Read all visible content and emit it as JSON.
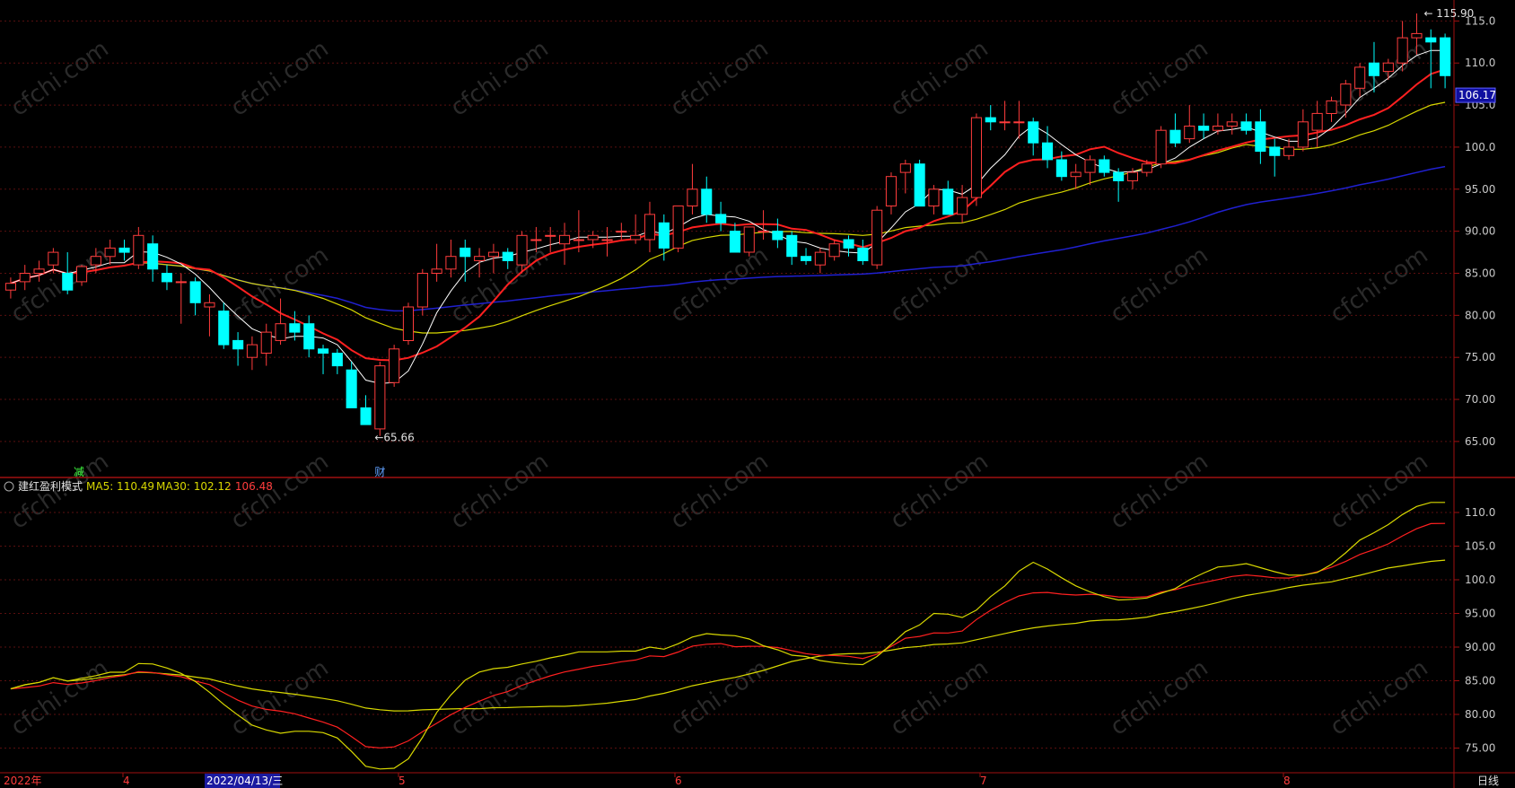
{
  "chart_data": [
    {
      "type": "candlestick",
      "panel": "main",
      "ylim": [
        62,
        116
      ],
      "yticks": [
        "115.0",
        "110.0",
        "105.0",
        "100.0",
        "95.00",
        "90.00",
        "85.00",
        "80.00",
        "75.00",
        "70.00",
        "65.00"
      ],
      "price_tag": "106.17",
      "high_annotation": "115.90",
      "low_annotation": "65.66",
      "markers": [
        "减",
        "财"
      ],
      "colors": {
        "up": "#ff3c3c",
        "down": "#00ffff",
        "ma5": "#ffffff",
        "ma10": "#ff2020",
        "ma20": "#d8d800",
        "ma60": "#2020d0"
      },
      "candles": [
        [
          83.0,
          84.5,
          82.0,
          83.8
        ],
        [
          84.0,
          86.0,
          83.0,
          85.0
        ],
        [
          85.0,
          86.5,
          84.0,
          85.5
        ],
        [
          86.0,
          88.0,
          85.0,
          87.5
        ],
        [
          85.0,
          87.5,
          82.5,
          83.0
        ],
        [
          84.0,
          86.0,
          83.5,
          85.8
        ],
        [
          86.0,
          88.0,
          85.0,
          87.0
        ],
        [
          87.0,
          89.0,
          86.0,
          88.0
        ],
        [
          88.0,
          89.0,
          86.5,
          87.5
        ],
        [
          86.0,
          90.5,
          85.5,
          89.5
        ],
        [
          88.5,
          89.5,
          84.0,
          85.5
        ],
        [
          85.0,
          86.0,
          83.0,
          84.0
        ],
        [
          84.0,
          85.0,
          79.0,
          84.0
        ],
        [
          84.0,
          84.5,
          80.0,
          81.5
        ],
        [
          81.0,
          82.5,
          77.5,
          81.5
        ],
        [
          80.5,
          81.5,
          76.0,
          76.5
        ],
        [
          77.0,
          78.0,
          74.0,
          76.0
        ],
        [
          75.0,
          77.5,
          73.5,
          76.5
        ],
        [
          75.5,
          79.0,
          74.0,
          78.0
        ],
        [
          77.0,
          82.0,
          76.5,
          79.0
        ],
        [
          79.0,
          80.5,
          77.0,
          78.0
        ],
        [
          79.0,
          80.0,
          75.0,
          76.0
        ],
        [
          76.0,
          76.5,
          73.0,
          75.5
        ],
        [
          75.5,
          76.0,
          73.0,
          74.0
        ],
        [
          73.5,
          74.5,
          69.0,
          69.0
        ],
        [
          69.0,
          70.5,
          67.0,
          67.0
        ],
        [
          66.5,
          74.5,
          65.66,
          74.0
        ],
        [
          72.0,
          76.5,
          71.5,
          76.0
        ],
        [
          77.0,
          81.5,
          76.5,
          81.0
        ],
        [
          81.0,
          85.5,
          80.0,
          85.0
        ],
        [
          85.0,
          88.5,
          84.0,
          85.5
        ],
        [
          85.5,
          89.0,
          84.5,
          87.0
        ],
        [
          88.0,
          89.0,
          84.0,
          87.0
        ],
        [
          86.5,
          88.0,
          84.5,
          87.0
        ],
        [
          87.0,
          88.5,
          85.0,
          87.5
        ],
        [
          87.5,
          88.0,
          85.5,
          86.5
        ],
        [
          86.0,
          90.0,
          85.0,
          89.5
        ],
        [
          89.0,
          90.5,
          87.5,
          89.0
        ],
        [
          89.5,
          90.5,
          87.5,
          89.5
        ],
        [
          88.5,
          91.0,
          86.0,
          89.5
        ],
        [
          89.0,
          92.5,
          87.5,
          89.0
        ],
        [
          89.0,
          90.0,
          88.0,
          89.5
        ],
        [
          89.0,
          90.5,
          87.0,
          89.0
        ],
        [
          90.0,
          91.0,
          89.0,
          90.0
        ],
        [
          89.0,
          92.0,
          88.5,
          89.5
        ],
        [
          89.0,
          93.5,
          87.5,
          92.0
        ],
        [
          91.0,
          92.0,
          86.5,
          88.0
        ],
        [
          88.0,
          93.0,
          87.5,
          93.0
        ],
        [
          93.0,
          98.0,
          92.0,
          95.0
        ],
        [
          95.0,
          96.5,
          91.0,
          92.0
        ],
        [
          92.0,
          93.5,
          90.0,
          91.0
        ],
        [
          90.0,
          91.0,
          87.5,
          87.5
        ],
        [
          87.5,
          90.5,
          87.0,
          90.5
        ],
        [
          90.0,
          92.5,
          89.0,
          90.0
        ],
        [
          90.0,
          91.5,
          88.0,
          89.0
        ],
        [
          89.5,
          90.0,
          86.0,
          87.0
        ],
        [
          87.0,
          88.0,
          86.0,
          86.5
        ],
        [
          86.0,
          88.0,
          85.0,
          87.5
        ],
        [
          87.0,
          89.0,
          86.5,
          88.5
        ],
        [
          89.0,
          89.5,
          87.0,
          88.0
        ],
        [
          88.0,
          89.0,
          86.0,
          86.5
        ],
        [
          86.0,
          93.0,
          85.5,
          92.5
        ],
        [
          93.0,
          97.0,
          92.0,
          96.5
        ],
        [
          97.0,
          98.5,
          94.5,
          98.0
        ],
        [
          98.0,
          98.5,
          93.0,
          93.0
        ],
        [
          93.0,
          95.5,
          92.0,
          95.0
        ],
        [
          95.0,
          96.0,
          92.0,
          92.0
        ],
        [
          92.0,
          95.5,
          91.0,
          94.0
        ],
        [
          94.0,
          104.0,
          93.0,
          103.5
        ],
        [
          103.5,
          105.0,
          102.0,
          103.0
        ],
        [
          103.0,
          105.5,
          102.0,
          103.0
        ],
        [
          103.0,
          105.5,
          101.0,
          103.0
        ],
        [
          103.0,
          103.5,
          99.0,
          100.5
        ],
        [
          100.5,
          102.5,
          97.5,
          98.5
        ],
        [
          98.5,
          99.5,
          96.0,
          96.5
        ],
        [
          96.5,
          98.0,
          95.0,
          97.0
        ],
        [
          97.0,
          99.0,
          95.5,
          98.5
        ],
        [
          98.5,
          99.0,
          96.5,
          97.0
        ],
        [
          97.0,
          97.5,
          93.5,
          96.0
        ],
        [
          96.0,
          97.5,
          95.0,
          97.0
        ],
        [
          97.0,
          98.5,
          96.5,
          98.0
        ],
        [
          98.0,
          102.5,
          97.5,
          102.0
        ],
        [
          102.0,
          104.0,
          100.0,
          100.5
        ],
        [
          101.0,
          105.0,
          100.5,
          102.5
        ],
        [
          102.5,
          104.0,
          101.0,
          102.0
        ],
        [
          102.0,
          104.0,
          101.5,
          102.5
        ],
        [
          102.5,
          104.0,
          101.5,
          103.0
        ],
        [
          103.0,
          104.0,
          101.5,
          102.0
        ],
        [
          103.0,
          104.5,
          98.0,
          99.5
        ],
        [
          100.0,
          101.0,
          96.5,
          99.0
        ],
        [
          99.0,
          101.0,
          98.5,
          100.0
        ],
        [
          100.0,
          104.5,
          99.5,
          103.0
        ],
        [
          102.0,
          105.5,
          100.0,
          104.0
        ],
        [
          104.0,
          106.0,
          103.0,
          105.5
        ],
        [
          105.0,
          108.0,
          103.5,
          107.5
        ],
        [
          107.0,
          110.0,
          106.0,
          109.5
        ],
        [
          110.0,
          112.5,
          106.5,
          108.5
        ],
        [
          109.0,
          110.5,
          108.0,
          110.0
        ],
        [
          110.0,
          115.0,
          109.0,
          113.0
        ],
        [
          113.0,
          115.9,
          111.0,
          113.5
        ],
        [
          113.0,
          114.0,
          107.0,
          112.5
        ],
        [
          113.0,
          113.5,
          107.0,
          108.5
        ]
      ]
    },
    {
      "type": "line",
      "panel": "indicator",
      "title": "建红盈利模式",
      "legend": [
        {
          "name": "MA5: 110.49",
          "color": "#d8d800"
        },
        {
          "name": "MA30: 102.12",
          "color": "#d8d800"
        },
        {
          "name": ": 106.48",
          "color": "#ff3c3c"
        }
      ],
      "ylim": [
        72,
        112
      ],
      "yticks": [
        "110.0",
        "105.0",
        "100.0",
        "95.00",
        "90.00",
        "85.00",
        "80.00",
        "75.00"
      ]
    }
  ],
  "xaxis": {
    "labels": [
      "2022年",
      "4",
      "2022/04/13/三",
      "5",
      "6",
      "7",
      "8"
    ],
    "period": "日线"
  },
  "watermark": "cfchi.com"
}
